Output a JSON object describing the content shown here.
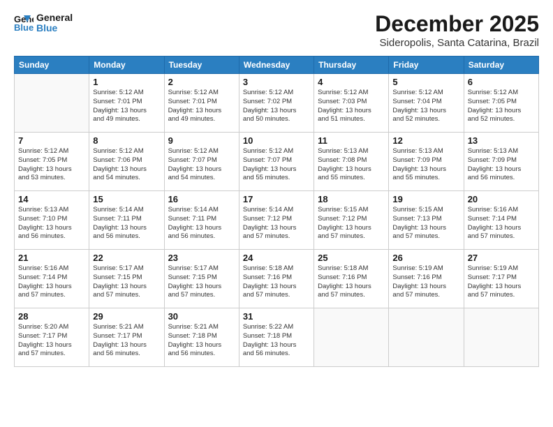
{
  "header": {
    "logo": {
      "line1": "General",
      "line2": "Blue"
    },
    "title": "December 2025",
    "location": "Sideropolis, Santa Catarina, Brazil"
  },
  "weekdays": [
    "Sunday",
    "Monday",
    "Tuesday",
    "Wednesday",
    "Thursday",
    "Friday",
    "Saturday"
  ],
  "weeks": [
    [
      {
        "day": "",
        "info": ""
      },
      {
        "day": "1",
        "info": "Sunrise: 5:12 AM\nSunset: 7:01 PM\nDaylight: 13 hours\nand 49 minutes."
      },
      {
        "day": "2",
        "info": "Sunrise: 5:12 AM\nSunset: 7:01 PM\nDaylight: 13 hours\nand 49 minutes."
      },
      {
        "day": "3",
        "info": "Sunrise: 5:12 AM\nSunset: 7:02 PM\nDaylight: 13 hours\nand 50 minutes."
      },
      {
        "day": "4",
        "info": "Sunrise: 5:12 AM\nSunset: 7:03 PM\nDaylight: 13 hours\nand 51 minutes."
      },
      {
        "day": "5",
        "info": "Sunrise: 5:12 AM\nSunset: 7:04 PM\nDaylight: 13 hours\nand 52 minutes."
      },
      {
        "day": "6",
        "info": "Sunrise: 5:12 AM\nSunset: 7:05 PM\nDaylight: 13 hours\nand 52 minutes."
      }
    ],
    [
      {
        "day": "7",
        "info": "Sunrise: 5:12 AM\nSunset: 7:05 PM\nDaylight: 13 hours\nand 53 minutes."
      },
      {
        "day": "8",
        "info": "Sunrise: 5:12 AM\nSunset: 7:06 PM\nDaylight: 13 hours\nand 54 minutes."
      },
      {
        "day": "9",
        "info": "Sunrise: 5:12 AM\nSunset: 7:07 PM\nDaylight: 13 hours\nand 54 minutes."
      },
      {
        "day": "10",
        "info": "Sunrise: 5:12 AM\nSunset: 7:07 PM\nDaylight: 13 hours\nand 55 minutes."
      },
      {
        "day": "11",
        "info": "Sunrise: 5:13 AM\nSunset: 7:08 PM\nDaylight: 13 hours\nand 55 minutes."
      },
      {
        "day": "12",
        "info": "Sunrise: 5:13 AM\nSunset: 7:09 PM\nDaylight: 13 hours\nand 55 minutes."
      },
      {
        "day": "13",
        "info": "Sunrise: 5:13 AM\nSunset: 7:09 PM\nDaylight: 13 hours\nand 56 minutes."
      }
    ],
    [
      {
        "day": "14",
        "info": "Sunrise: 5:13 AM\nSunset: 7:10 PM\nDaylight: 13 hours\nand 56 minutes."
      },
      {
        "day": "15",
        "info": "Sunrise: 5:14 AM\nSunset: 7:11 PM\nDaylight: 13 hours\nand 56 minutes."
      },
      {
        "day": "16",
        "info": "Sunrise: 5:14 AM\nSunset: 7:11 PM\nDaylight: 13 hours\nand 56 minutes."
      },
      {
        "day": "17",
        "info": "Sunrise: 5:14 AM\nSunset: 7:12 PM\nDaylight: 13 hours\nand 57 minutes."
      },
      {
        "day": "18",
        "info": "Sunrise: 5:15 AM\nSunset: 7:12 PM\nDaylight: 13 hours\nand 57 minutes."
      },
      {
        "day": "19",
        "info": "Sunrise: 5:15 AM\nSunset: 7:13 PM\nDaylight: 13 hours\nand 57 minutes."
      },
      {
        "day": "20",
        "info": "Sunrise: 5:16 AM\nSunset: 7:14 PM\nDaylight: 13 hours\nand 57 minutes."
      }
    ],
    [
      {
        "day": "21",
        "info": "Sunrise: 5:16 AM\nSunset: 7:14 PM\nDaylight: 13 hours\nand 57 minutes."
      },
      {
        "day": "22",
        "info": "Sunrise: 5:17 AM\nSunset: 7:15 PM\nDaylight: 13 hours\nand 57 minutes."
      },
      {
        "day": "23",
        "info": "Sunrise: 5:17 AM\nSunset: 7:15 PM\nDaylight: 13 hours\nand 57 minutes."
      },
      {
        "day": "24",
        "info": "Sunrise: 5:18 AM\nSunset: 7:16 PM\nDaylight: 13 hours\nand 57 minutes."
      },
      {
        "day": "25",
        "info": "Sunrise: 5:18 AM\nSunset: 7:16 PM\nDaylight: 13 hours\nand 57 minutes."
      },
      {
        "day": "26",
        "info": "Sunrise: 5:19 AM\nSunset: 7:16 PM\nDaylight: 13 hours\nand 57 minutes."
      },
      {
        "day": "27",
        "info": "Sunrise: 5:19 AM\nSunset: 7:17 PM\nDaylight: 13 hours\nand 57 minutes."
      }
    ],
    [
      {
        "day": "28",
        "info": "Sunrise: 5:20 AM\nSunset: 7:17 PM\nDaylight: 13 hours\nand 57 minutes."
      },
      {
        "day": "29",
        "info": "Sunrise: 5:21 AM\nSunset: 7:17 PM\nDaylight: 13 hours\nand 56 minutes."
      },
      {
        "day": "30",
        "info": "Sunrise: 5:21 AM\nSunset: 7:18 PM\nDaylight: 13 hours\nand 56 minutes."
      },
      {
        "day": "31",
        "info": "Sunrise: 5:22 AM\nSunset: 7:18 PM\nDaylight: 13 hours\nand 56 minutes."
      },
      {
        "day": "",
        "info": ""
      },
      {
        "day": "",
        "info": ""
      },
      {
        "day": "",
        "info": ""
      }
    ]
  ]
}
